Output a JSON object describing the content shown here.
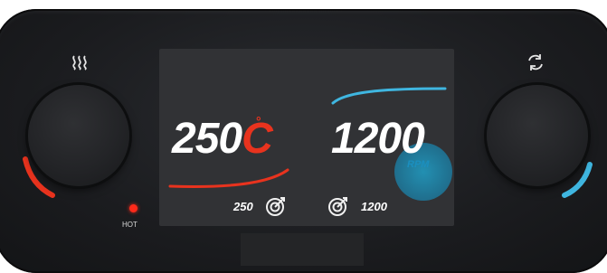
{
  "heater": {
    "temperature_value": "250",
    "degree_symbol": "°",
    "temperature_unit": "C",
    "target_temperature": "250",
    "status_label": "HOT"
  },
  "stirrer": {
    "speed_value": "1200",
    "speed_unit": "RPM",
    "target_speed": "1200"
  },
  "icons": {
    "heat": "heat-waves-icon",
    "rotate": "rotate-arrows-icon",
    "target": "target-dial-icon"
  },
  "colors": {
    "heat_accent": "#e8331e",
    "stir_accent": "#3fb6e0",
    "body": "#1b1c1f",
    "screen": "#313235"
  }
}
